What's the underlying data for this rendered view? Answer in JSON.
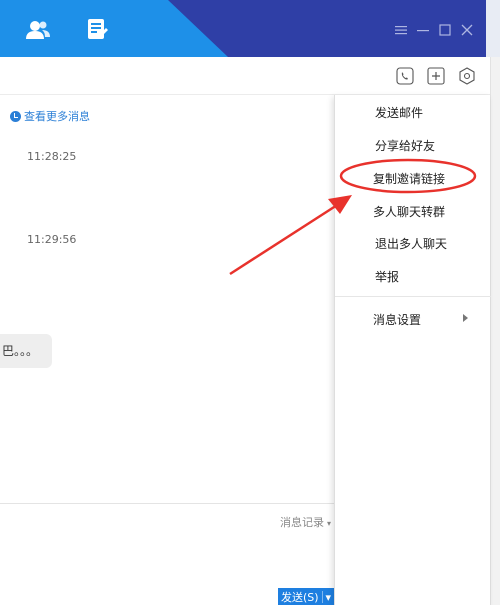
{
  "chat": {
    "more_messages": "查看更多消息",
    "time_1": "11:28:25",
    "time_2": "11:29:56",
    "bubble_text": "巴。。。"
  },
  "footer": {
    "history_label": "消息记录",
    "history_caret": "▾",
    "send_label": "发送(S)",
    "send_caret": "▾"
  },
  "menu": {
    "items": [
      "发送邮件",
      "分享给好友",
      "复制邀请链接",
      "多人聊天转群",
      "退出多人聊天",
      "举报",
      "消息设置"
    ]
  },
  "colors": {
    "header_blue": "#1e90e8",
    "header_dark": "#2f3fa6",
    "annotation_red": "#e8322c",
    "link_blue": "#2b7fd6"
  },
  "icons": {
    "contacts": "contacts-icon",
    "notes": "notes-icon",
    "menu": "menu-icon",
    "minimize": "minimize-icon",
    "maximize": "maximize-icon",
    "close": "close-icon",
    "phone": "phone-icon",
    "add": "add-icon",
    "settings": "settings-icon"
  }
}
